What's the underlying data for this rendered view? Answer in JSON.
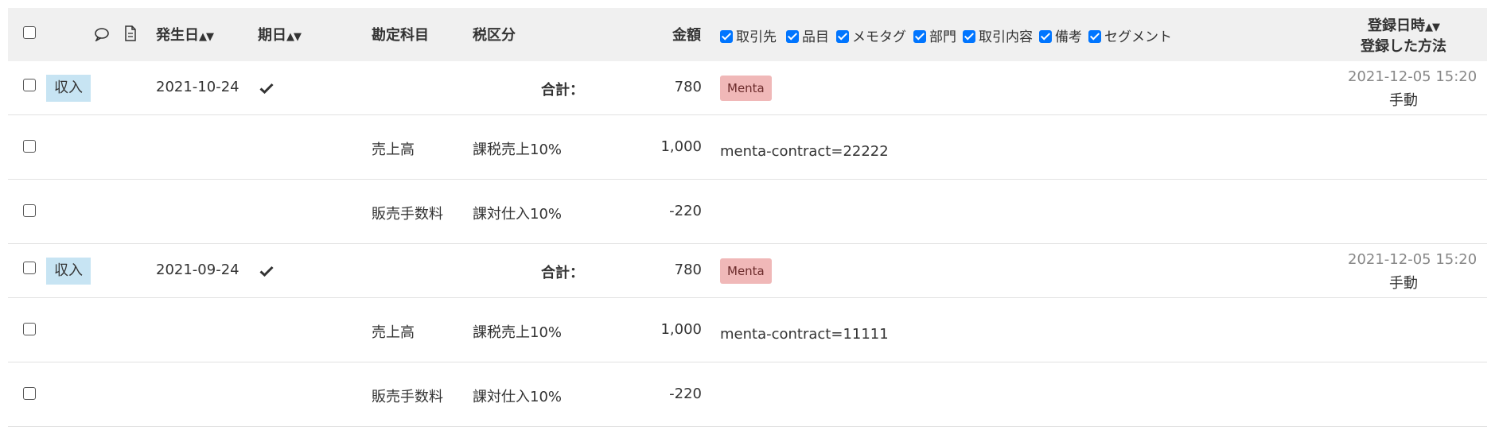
{
  "header": {
    "issue_date": "発生日",
    "due_date": "期日",
    "account": "勘定科目",
    "tax": "税区分",
    "amount": "金額",
    "registered_at": "登録日時",
    "registered_method": "登録した方法",
    "column_options": [
      {
        "label": "取引先",
        "checked": true
      },
      {
        "label": "品目",
        "checked": true
      },
      {
        "label": "メモタグ",
        "checked": true
      },
      {
        "label": "部門",
        "checked": true
      },
      {
        "label": "取引内容",
        "checked": true
      },
      {
        "label": "備考",
        "checked": true
      },
      {
        "label": "セグメント",
        "checked": true
      }
    ]
  },
  "transactions": [
    {
      "type": "収入",
      "issue_date": "2021-10-24",
      "total_label": "合計：",
      "total": "780",
      "tag": "Menta",
      "registered_at": "2021-12-05 15:20",
      "method": "手動",
      "lines": [
        {
          "account": "売上高",
          "tax": "課税売上10%",
          "amount": "1,000",
          "memo": "menta-contract=22222"
        },
        {
          "account": "販売手数料",
          "tax": "課対仕入10%",
          "amount": "-220",
          "memo": ""
        }
      ]
    },
    {
      "type": "収入",
      "issue_date": "2021-09-24",
      "total_label": "合計：",
      "total": "780",
      "tag": "Menta",
      "registered_at": "2021-12-05 15:20",
      "method": "手動",
      "lines": [
        {
          "account": "売上高",
          "tax": "課税売上10%",
          "amount": "1,000",
          "memo": "menta-contract=11111"
        },
        {
          "account": "販売手数料",
          "tax": "課対仕入10%",
          "amount": "-220",
          "memo": ""
        }
      ]
    }
  ],
  "colors": {
    "header_bg": "#f0f0f0",
    "income_badge": "#c7e4f3",
    "tag_bg": "#f0b8b8",
    "checkbox_checked": "#0075ff"
  }
}
